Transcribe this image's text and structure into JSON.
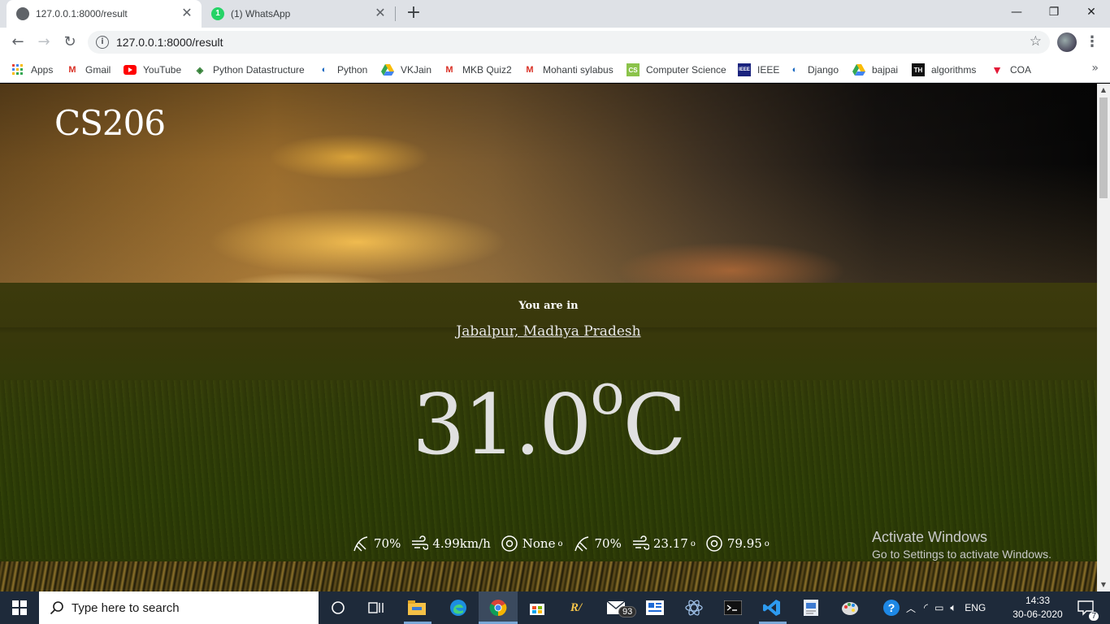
{
  "browser": {
    "tabs": [
      {
        "title": "127.0.0.1:8000/result",
        "active": true
      },
      {
        "title": "(1) WhatsApp",
        "active": false
      }
    ],
    "url": "127.0.0.1:8000/result",
    "window_controls": {
      "minimize": "—",
      "restore": "❐",
      "close": "✕"
    }
  },
  "bookmarks": [
    {
      "label": "Apps",
      "icon": "apps-grid-icon"
    },
    {
      "label": "Gmail",
      "icon": "gmail-icon"
    },
    {
      "label": "YouTube",
      "icon": "youtube-icon"
    },
    {
      "label": "Python Datastructure",
      "icon": "diamond-icon"
    },
    {
      "label": "Python",
      "icon": "python-icon"
    },
    {
      "label": "VKJain",
      "icon": "drive-icon"
    },
    {
      "label": "MKB Quiz2",
      "icon": "gmail-icon"
    },
    {
      "label": "Mohanti sylabus",
      "icon": "gmail-icon"
    },
    {
      "label": "Computer Science",
      "icon": "green-site-icon"
    },
    {
      "label": "IEEE",
      "icon": "ieee-icon"
    },
    {
      "label": "Django",
      "icon": "django-icon"
    },
    {
      "label": "bajpai",
      "icon": "drive-icon"
    },
    {
      "label": "algorithms",
      "icon": "th-icon"
    },
    {
      "label": "COA",
      "icon": "tesla-icon"
    }
  ],
  "page": {
    "logo": "CS206",
    "you_are_in": "You are in",
    "location": "Jabalpur, Madhya Pradesh",
    "temperature": "31.0",
    "temp_degree": "o",
    "temp_unit": "C",
    "stats": [
      {
        "icon": "humidity-icon",
        "value": "70%",
        "sup": ""
      },
      {
        "icon": "wind-icon",
        "value": "4.99km/h",
        "sup": ""
      },
      {
        "icon": "compass-icon",
        "value": "None",
        "sup": "o"
      },
      {
        "icon": "humidity-icon",
        "value": "70%",
        "sup": ""
      },
      {
        "icon": "wind-icon",
        "value": "23.17",
        "sup": "o"
      },
      {
        "icon": "compass-icon",
        "value": "79.95",
        "sup": "o"
      }
    ]
  },
  "watermark": {
    "line1": "Activate Windows",
    "line2": "Go to Settings to activate Windows."
  },
  "taskbar": {
    "search_placeholder": "Type here to search",
    "mail_badge": "93",
    "language": "ENG",
    "time": "14:33",
    "date": "30-06-2020",
    "notification_count": "7"
  }
}
